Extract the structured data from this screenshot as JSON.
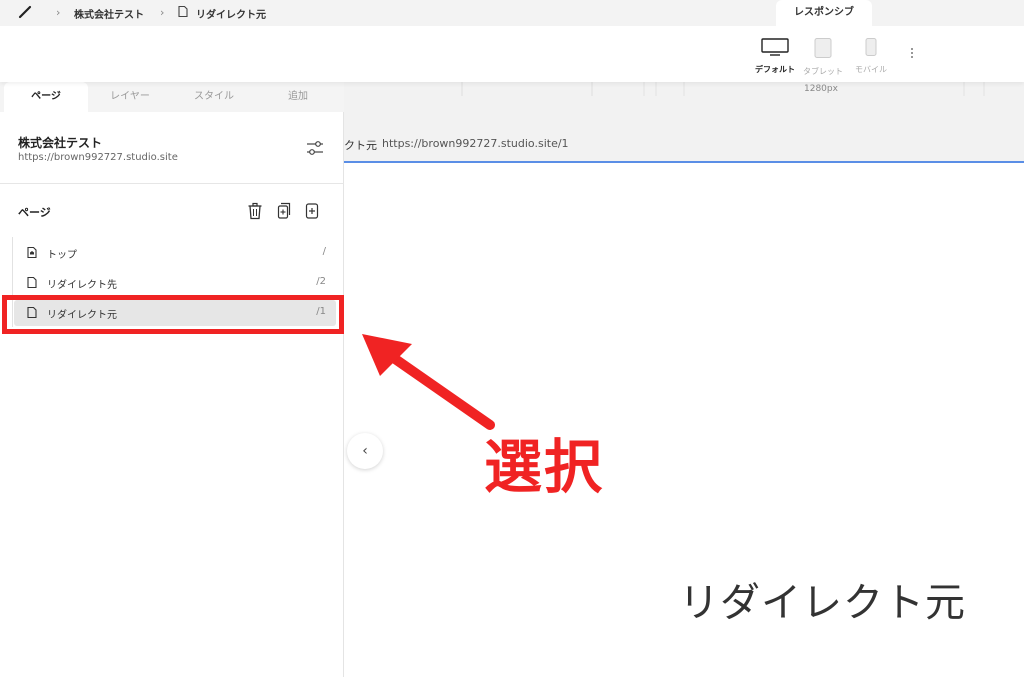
{
  "header": {
    "breadcrumbs": [
      "株式会社テスト",
      "リダイレクト元"
    ],
    "mode_tab": "レスポンシブ",
    "devices": [
      {
        "label": "デフォルト",
        "active": true
      },
      {
        "label": "タブレット",
        "active": false
      },
      {
        "label": "モバイル",
        "active": false
      }
    ]
  },
  "panel": {
    "tabs": [
      {
        "label": "ページ",
        "active": true
      },
      {
        "label": "レイヤー",
        "active": false
      },
      {
        "label": "スタイル",
        "active": false
      },
      {
        "label": "追加",
        "active": false
      }
    ],
    "site": {
      "name": "株式会社テスト",
      "url": "https://brown992727.studio.site"
    },
    "pages_heading": "ページ",
    "pages": [
      {
        "label": "トップ",
        "path": "/",
        "icon": "home-page-icon",
        "selected": false
      },
      {
        "label": "リダイレクト先",
        "path": "/2",
        "icon": "page-icon",
        "selected": false
      },
      {
        "label": "リダイレクト元",
        "path": "/1",
        "icon": "page-icon",
        "selected": true
      }
    ]
  },
  "canvas": {
    "width_label": "1280px",
    "page_name": "クト元",
    "page_url": "https://brown992727.studio.site/1",
    "heading": "リダイレクト元"
  },
  "annotation": {
    "text": "選択",
    "color": "#f02323"
  },
  "colors": {
    "accent_line": "#5a8ee6",
    "annotation": "#f02323"
  }
}
